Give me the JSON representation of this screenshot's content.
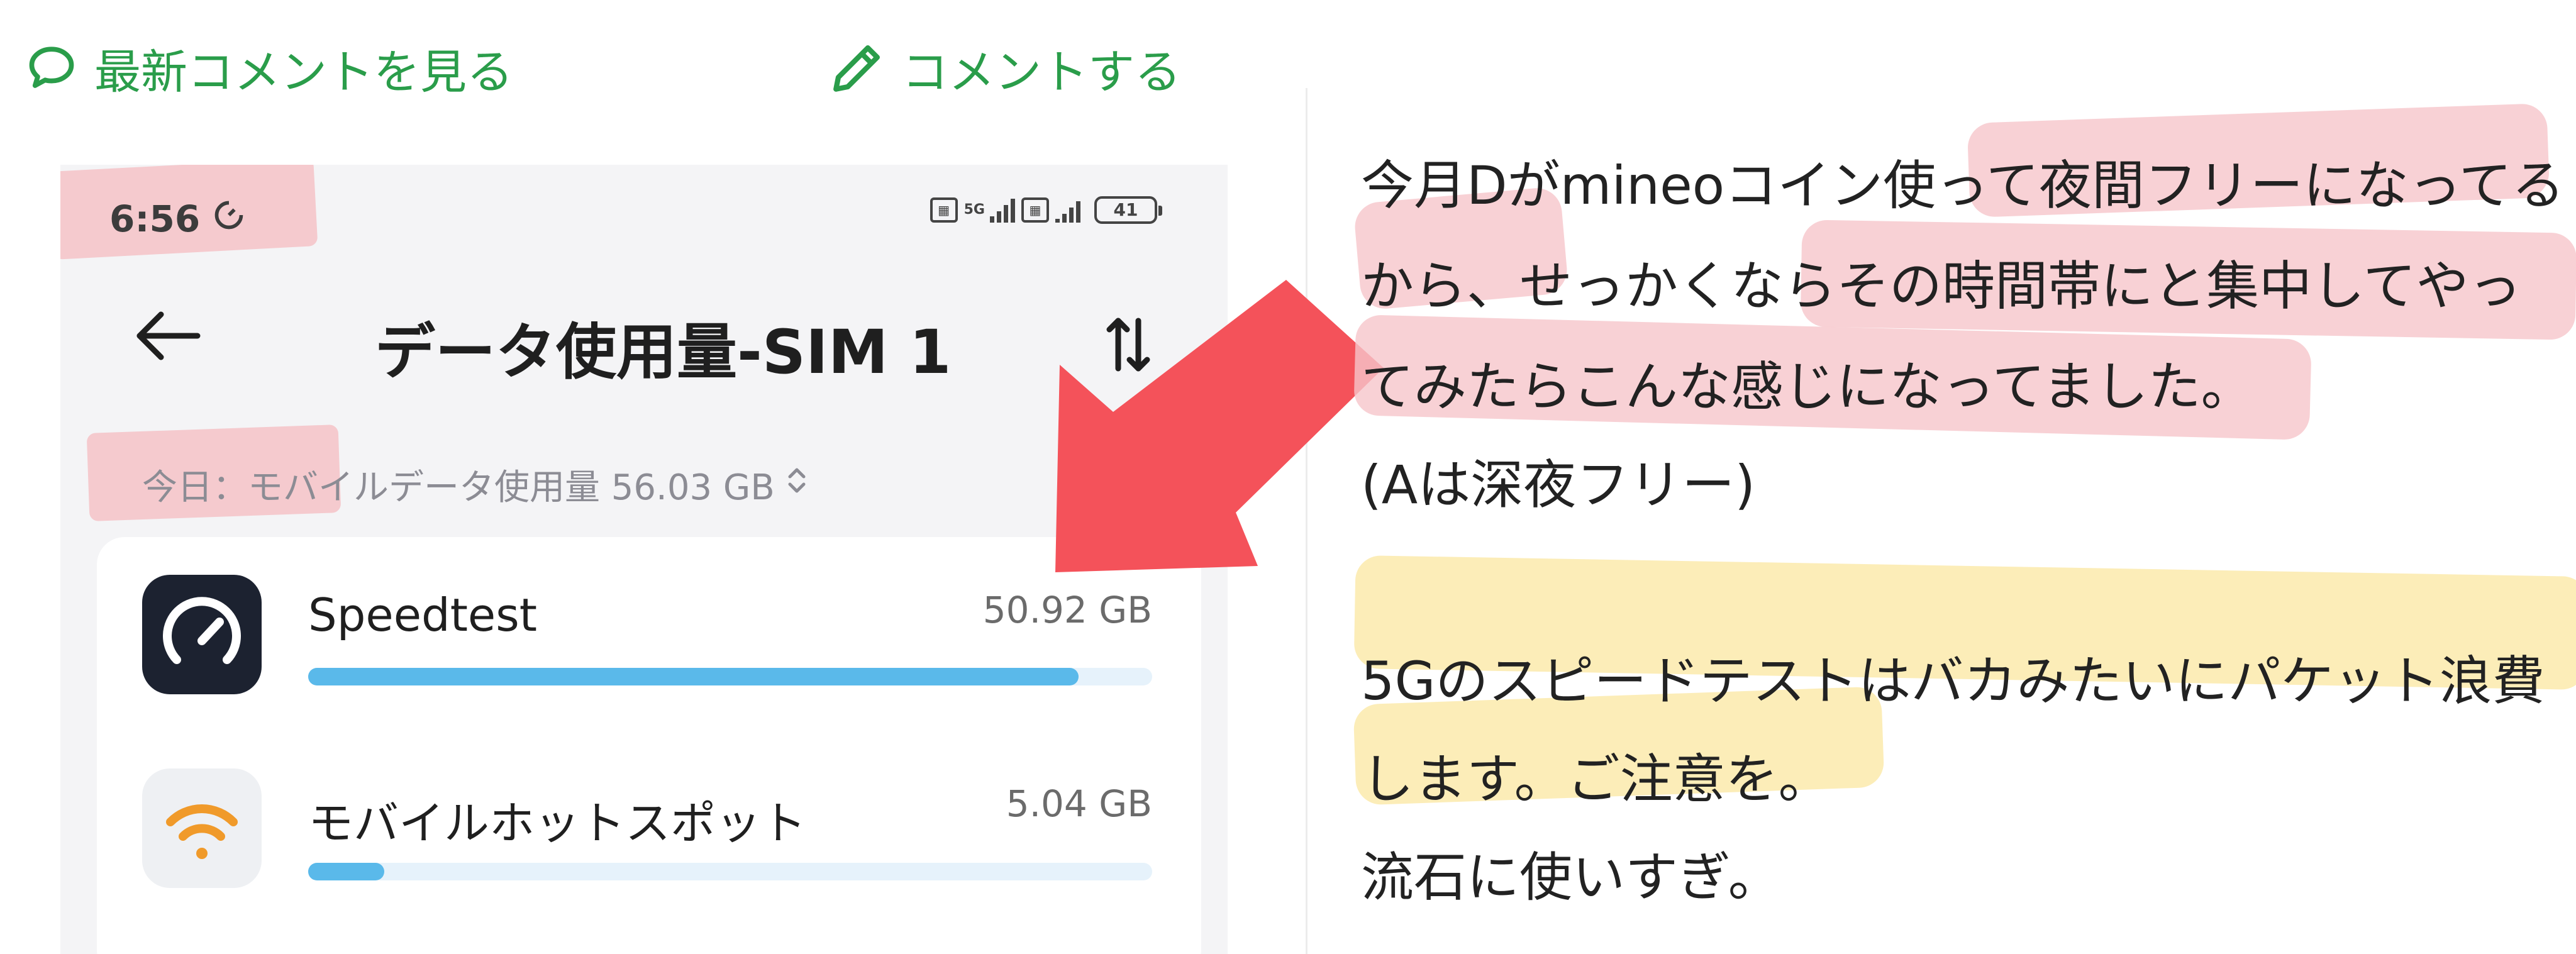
{
  "header": {
    "latest_comments_label": "最新コメントを見る",
    "post_comment_label": "コメントする",
    "accent_color": "#2a9d4a"
  },
  "phone": {
    "status_time": "6:56",
    "battery_level": "41",
    "network_gen": "5G",
    "screen_title": "データ使用量-SIM 1",
    "today_summary": "今日：モバイルデータ使用量 56.03 GB",
    "apps": [
      {
        "name": "Speedtest",
        "usage": "50.92 GB",
        "usage_fraction": 0.913,
        "icon": "speedometer-icon",
        "icon_bg": "#1c2230"
      },
      {
        "name": "モバイルホットスポット",
        "usage": "5.04 GB",
        "usage_fraction": 0.09,
        "icon": "wifi-hotspot-icon",
        "icon_bg": "#eef0f3"
      }
    ],
    "bar_color": "#5ab9ea"
  },
  "comment": {
    "lines": [
      "今月Dがmineoコイン使って夜間フリーになってる",
      "から、せっかくならその時間帯にと集中してやっ",
      "てみたらこんな感じになってました。",
      "(Aは深夜フリー)",
      "5Gのスピードテストはバカみたいにパケット浪費",
      "します。ご注意を。",
      "流石に使いすぎ。"
    ],
    "highlight_pink": "#f6c5cb",
    "highlight_yellow": "#fbe8a6"
  },
  "annotation_arrow_color": "#f4525a"
}
